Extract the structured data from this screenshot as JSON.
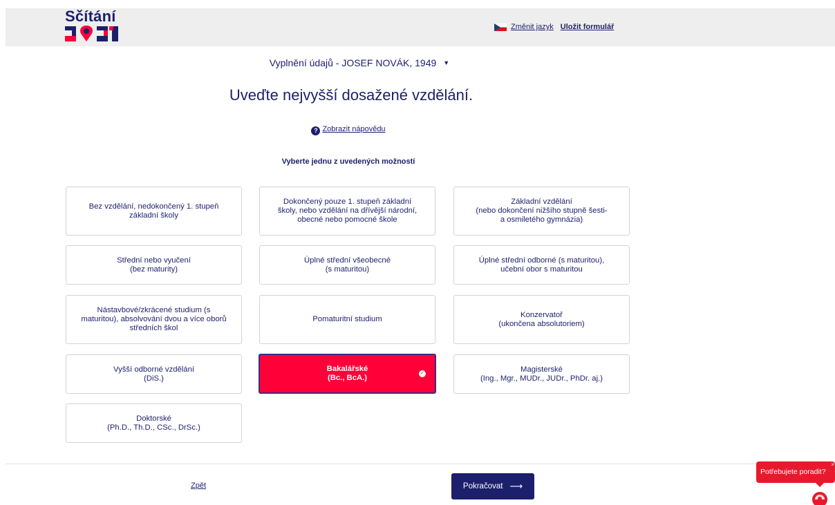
{
  "header": {
    "logo_top": "Sčítání",
    "logo_year_label": "2021",
    "change_language": "Změnit jazyk",
    "save_form": "Uložit formulář",
    "colors": {
      "navy": "#1c1f6b",
      "red": "#ff0038",
      "bar": "#eeeeee"
    }
  },
  "person": {
    "label": "Vyplnění údajů - JOSEF NOVÁK, 1949"
  },
  "question": "Uveďte nejvyšší dosažené vzdělání.",
  "help_link": "Zobrazit nápovědu",
  "instruction": "Vyberte jednu z uvedených možností",
  "options": [
    {
      "label": "Bez vzdělání, nedokončený 1. stupeň\nzákladní školy",
      "selected": false
    },
    {
      "label": "Dokončený pouze 1. stupeň základní\nškoly, nebo vzdělání na dřívější národní,\nobecné nebo pomocné škole",
      "selected": false
    },
    {
      "label": "Základní vzdělání\n(nebo dokončení nižšího stupně šesti-\na osmiletého gymnázia)",
      "selected": false
    },
    {
      "label": "Střední nebo vyučení\n(bez maturity)",
      "selected": false
    },
    {
      "label": "Úplné střední všeobecné\n(s maturitou)",
      "selected": false
    },
    {
      "label": "Úplné střední odborné (s maturitou),\nučební obor s maturitou",
      "selected": false
    },
    {
      "label": "Nástavbové/zkrácené studium (s\nmaturitou), absolvování dvou a více oborů\nstředních škol",
      "selected": false
    },
    {
      "label": "Pomaturitní studium",
      "selected": false
    },
    {
      "label": "Konzervatoř\n(ukončena absolutoriem)",
      "selected": false
    },
    {
      "label": "Vyšší odborné vzdělání\n(DiS.)",
      "selected": false
    },
    {
      "label": "Bakalářské\n(Bc., BcA.)",
      "selected": true
    },
    {
      "label": "Magisterské\n(Ing., Mgr., MUDr., JUDr., PhDr. aj.)",
      "selected": false
    },
    {
      "label": "Doktorské\n(Ph.D., Th.D., CSc., DrSc.)",
      "selected": false
    }
  ],
  "nav": {
    "back": "Zpět",
    "continue": "Pokračovat",
    "continue_arrow": "⟶"
  },
  "chat": {
    "label": "Potřebujete poradit?",
    "close": "×"
  }
}
